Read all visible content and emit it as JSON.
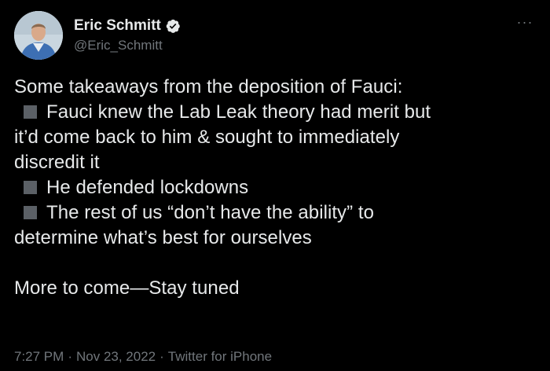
{
  "author": {
    "display_name": "Eric Schmitt",
    "handle": "@Eric_Schmitt",
    "verified": true,
    "avatar_icon": "profile-photo"
  },
  "menu": {
    "icon": "more-horizontal-icon",
    "glyph": "···"
  },
  "tweet": {
    "lines": [
      "Some takeaways from the deposition of Fauci:",
      "Fauci knew the Lab Leak theory had merit but",
      "it’d come back to him & sought to immediately",
      "discredit it",
      "He defended lockdowns",
      "The rest of us “don’t have the ability” to",
      "determine what’s best for ourselves",
      "More to come—Stay tuned"
    ]
  },
  "meta": {
    "time": "7:27 PM",
    "date": "Nov 23, 2022",
    "source": "Twitter for iPhone",
    "separator": "·"
  },
  "colors": {
    "background": "#000000",
    "text_primary": "#e7e9ea",
    "text_secondary": "#71767b",
    "verified_badge": "#e7e9ea",
    "bullet_square": "#5b6066"
  }
}
